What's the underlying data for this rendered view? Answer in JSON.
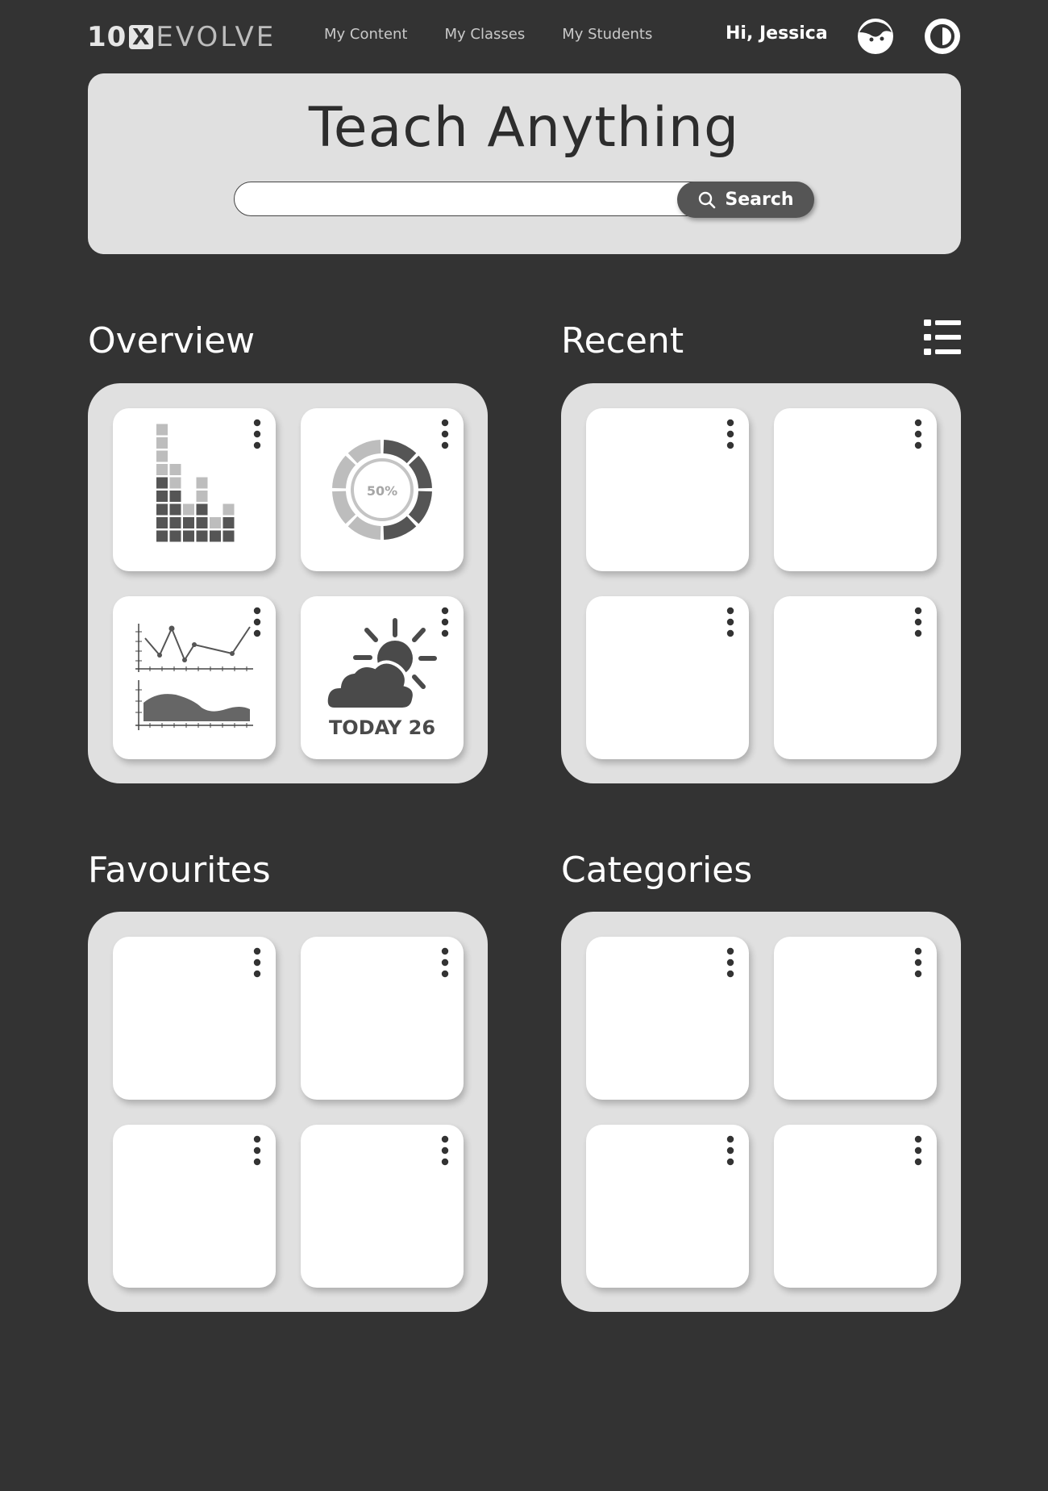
{
  "header": {
    "logo_prefix": "10",
    "logo_x": "X",
    "logo_suffix": "EVOLVE",
    "nav": [
      "My Content",
      "My Classes",
      "My Students"
    ],
    "greeting": "Hi, Jessica"
  },
  "hero": {
    "title": "Teach Anything",
    "search_value": "",
    "search_button": "Search"
  },
  "sections": {
    "overview": "Overview",
    "recent": "Recent",
    "favourites": "Favourites",
    "categories": "Categories"
  },
  "overview_cards": {
    "bar_chart": "bar-chart-widget",
    "donut_chart": {
      "label": "50%",
      "value": 0.5
    },
    "line_area_chart": "line-area-chart-widget",
    "weather": {
      "label": "TODAY 26",
      "icon": "partly-cloudy-icon"
    }
  },
  "colors": {
    "background": "#333333",
    "panel": "#e0e0e0",
    "card": "#ffffff",
    "accent_dark": "#555555"
  }
}
